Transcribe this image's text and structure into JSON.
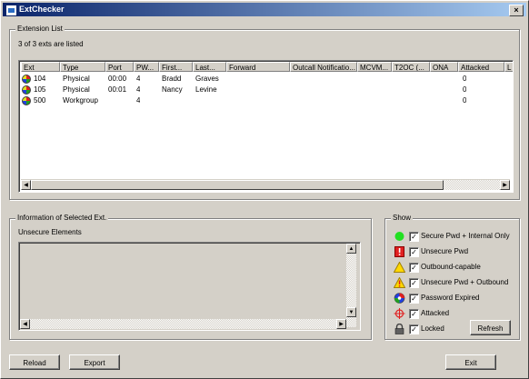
{
  "window": {
    "title": "ExtChecker",
    "close_label": "×"
  },
  "ext_list": {
    "legend": "Extension List",
    "count_text": "3 of 3 exts are listed",
    "columns": [
      "Ext",
      "Type",
      "Port",
      "PW...",
      "First...",
      "Last...",
      "Forward",
      "Outcall Notificatio...",
      "MCVM...",
      "T2OC (...",
      "ONA",
      "Attacked",
      "L"
    ],
    "rows": [
      {
        "ext": "104",
        "type": "Physical",
        "port": "00:00",
        "pw": "4",
        "first": "Bradd",
        "last": "Graves",
        "attacked": "0"
      },
      {
        "ext": "105",
        "type": "Physical",
        "port": "00:01",
        "pw": "4",
        "first": "Nancy",
        "last": "Levine",
        "attacked": "0"
      },
      {
        "ext": "500",
        "type": "Workgroup",
        "port": "",
        "pw": "4",
        "first": "",
        "last": "",
        "attacked": "0"
      }
    ]
  },
  "info": {
    "legend": "Information of Selected Ext.",
    "subtitle": "Unsecure Elements"
  },
  "show": {
    "legend": "Show",
    "items": [
      {
        "icon": "green-circle-icon",
        "label": "Secure Pwd + Internal Only",
        "checked": true
      },
      {
        "icon": "red-exclamation-icon",
        "label": "Unsecure Pwd",
        "checked": true
      },
      {
        "icon": "yellow-triangle-icon",
        "label": "Outbound-capable",
        "checked": true
      },
      {
        "icon": "warning-triangle-icon",
        "label": "Unsecure Pwd + Outbound",
        "checked": true
      },
      {
        "icon": "password-expired-icon",
        "label": "Password Expired",
        "checked": true
      },
      {
        "icon": "crosshair-icon",
        "label": "Attacked",
        "checked": true
      },
      {
        "icon": "lock-icon",
        "label": "Locked",
        "checked": true
      }
    ],
    "refresh_label": "Refresh"
  },
  "buttons": {
    "reload": "Reload",
    "export": "Export",
    "exit": "Exit"
  }
}
